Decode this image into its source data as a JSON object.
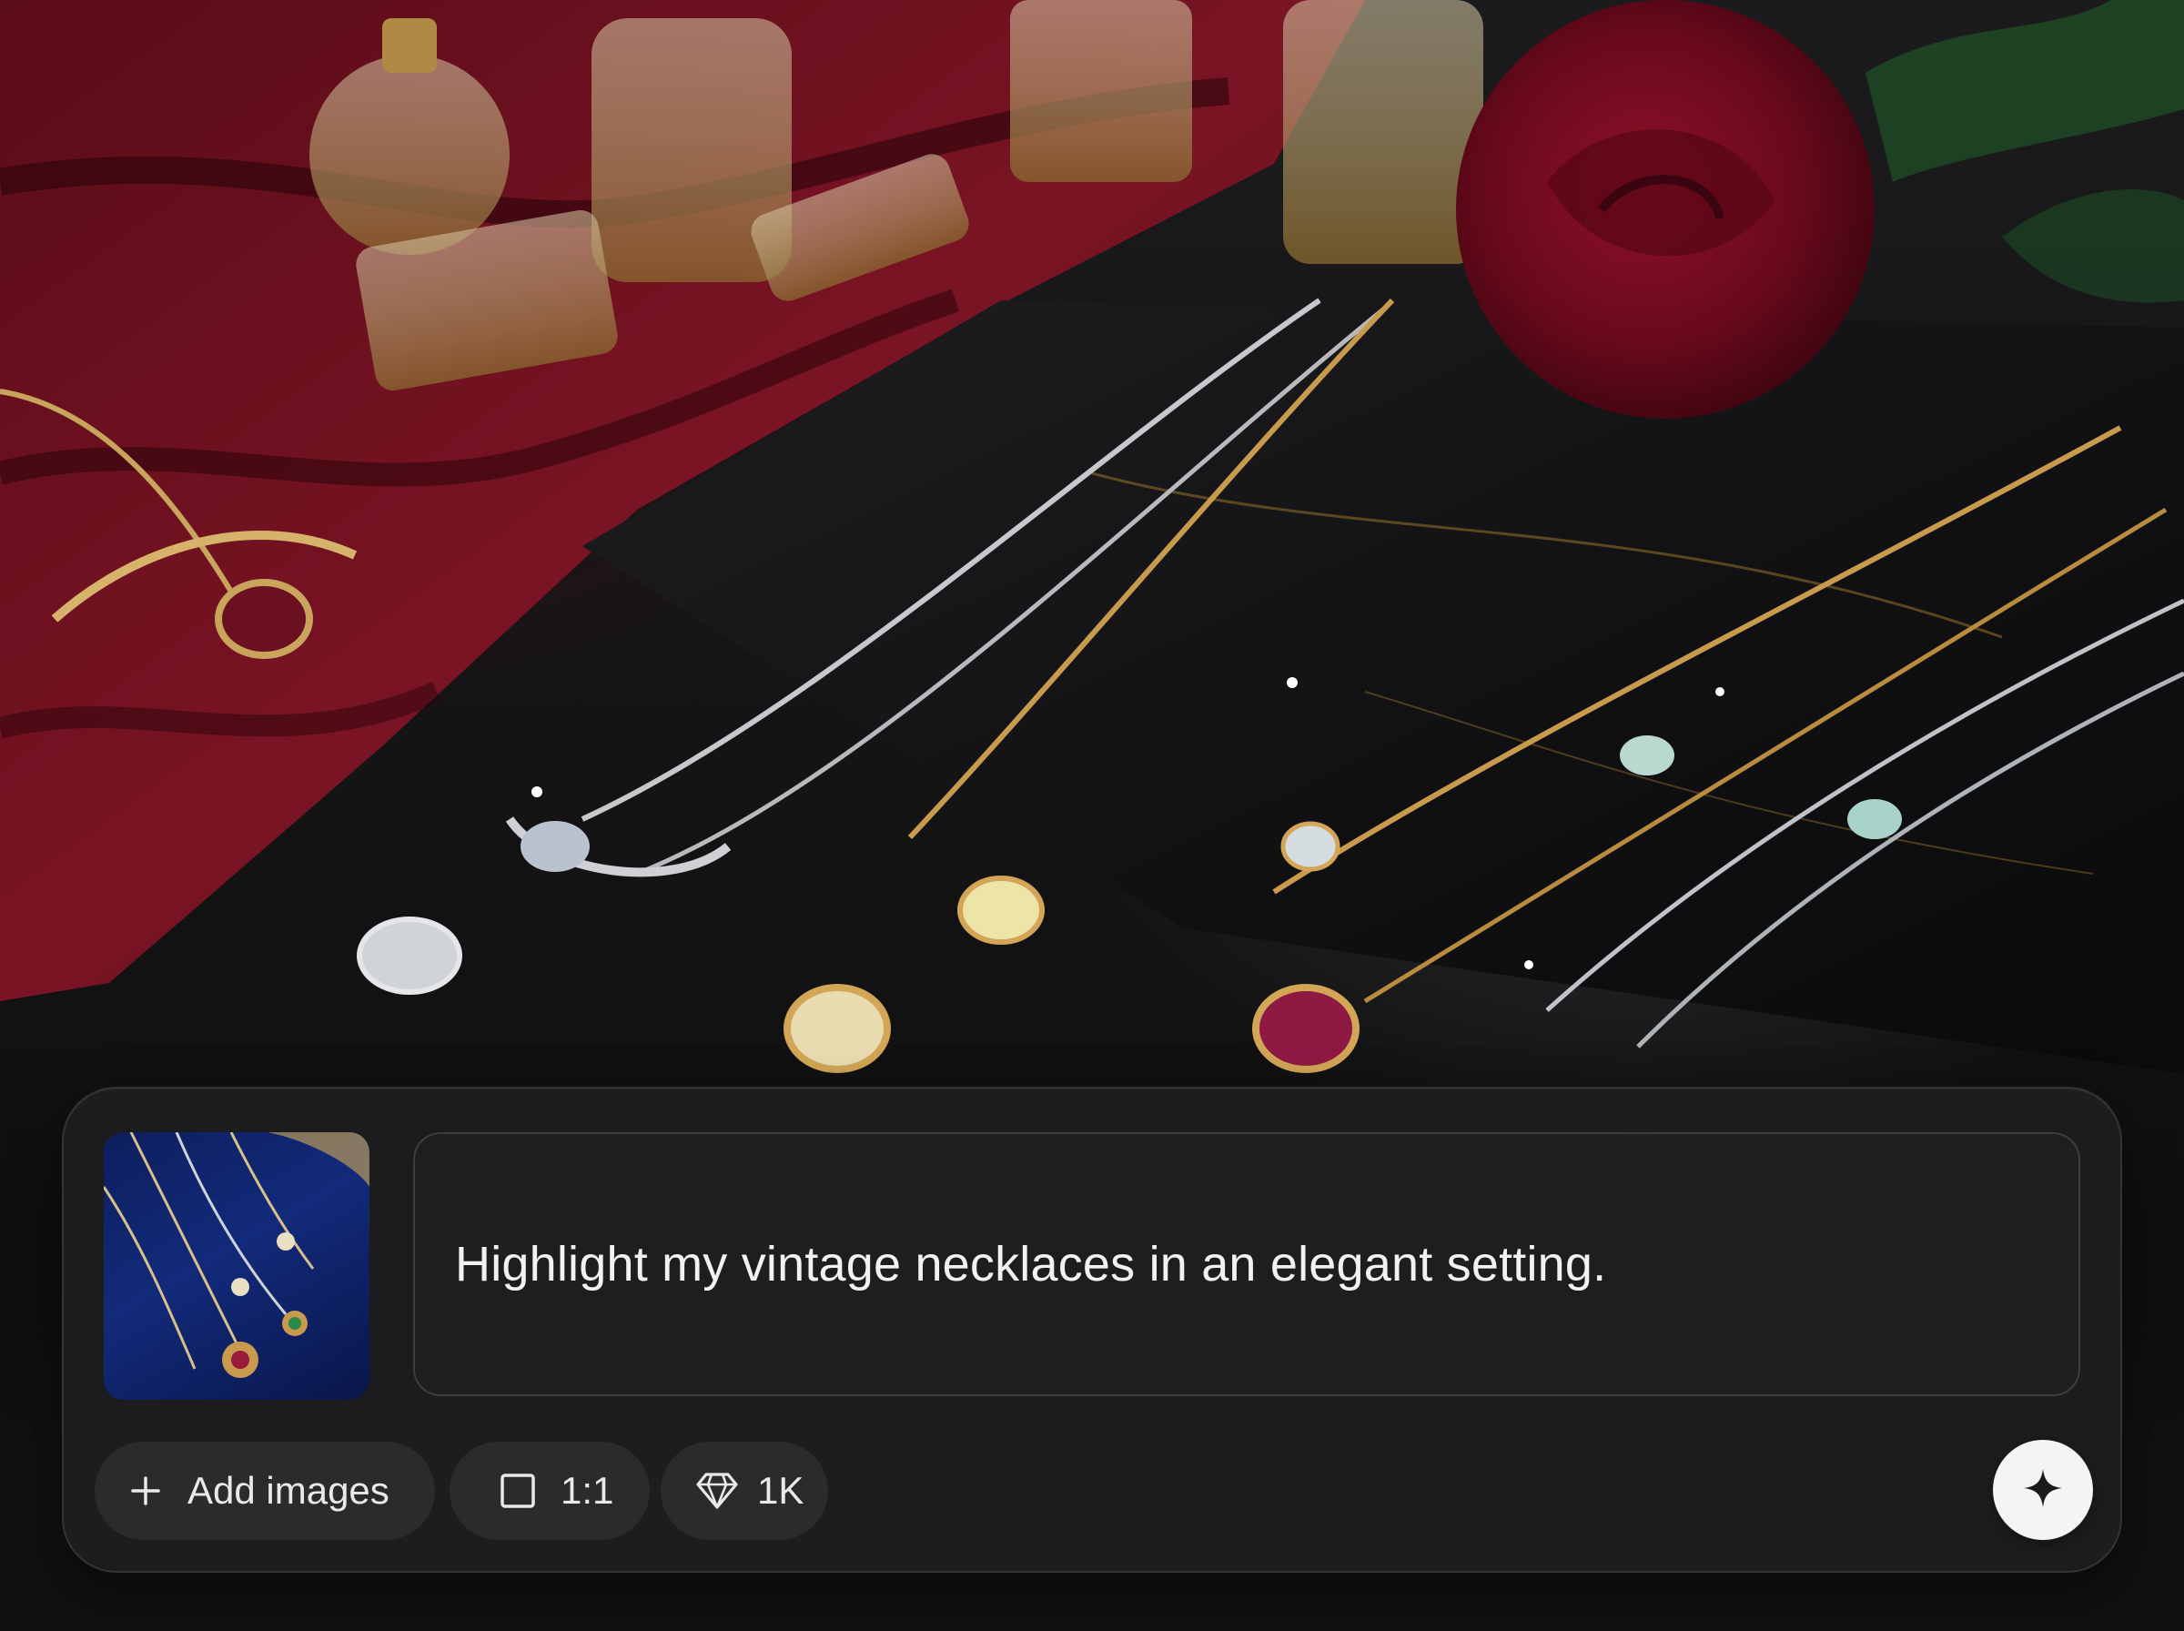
{
  "composer": {
    "prompt_text": "Highlight my vintage necklaces in an elegant setting.",
    "thumbnail_icon": "necklace-reference-thumbnail",
    "buttons": {
      "add_images_label": "Add images",
      "add_images_icon": "plus-icon",
      "aspect_ratio_label": "1:1",
      "aspect_ratio_icon": "square-icon",
      "resolution_label": "1K",
      "resolution_icon": "diamond-icon",
      "generate_icon": "sparkle-icon"
    }
  },
  "colors": {
    "panel": "#202022",
    "chip": "#2b2b2e",
    "text": "#f2f2f2",
    "generate_button": "#f4f4f4"
  }
}
